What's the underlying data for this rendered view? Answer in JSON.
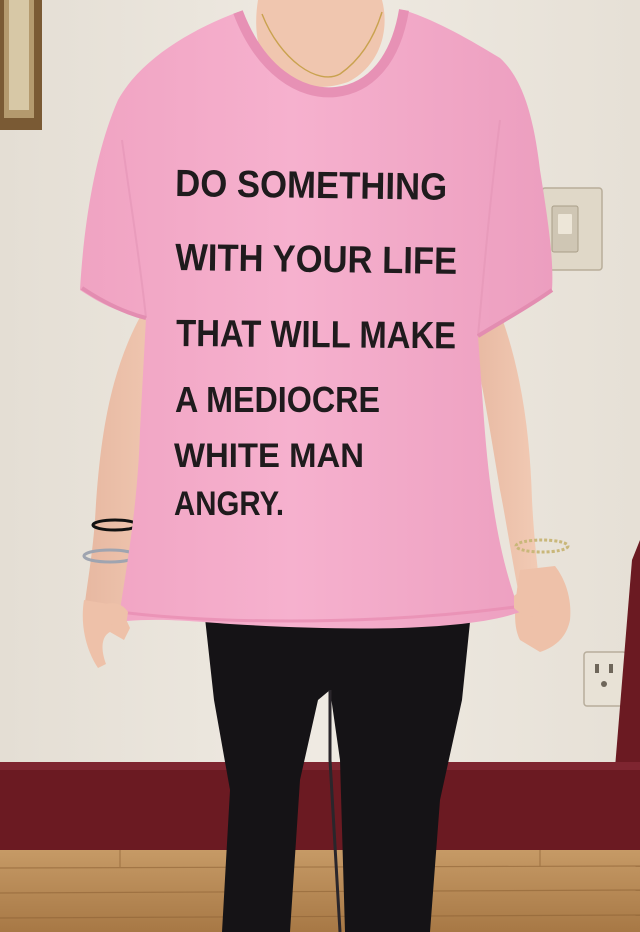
{
  "shirt": {
    "lines": [
      "DO SOMETHING",
      "WITH YOUR LIFE",
      "THAT WILL MAKE",
      "A MEDIOCRE",
      "WHITE MAN",
      "ANGRY."
    ]
  },
  "colors": {
    "wall": "#ece7df",
    "shirt": "#f4a9c8",
    "print": "#1f1b1d",
    "baseboard": "#6b1a22",
    "floor": "#b88a57",
    "leggings": "#151316"
  }
}
